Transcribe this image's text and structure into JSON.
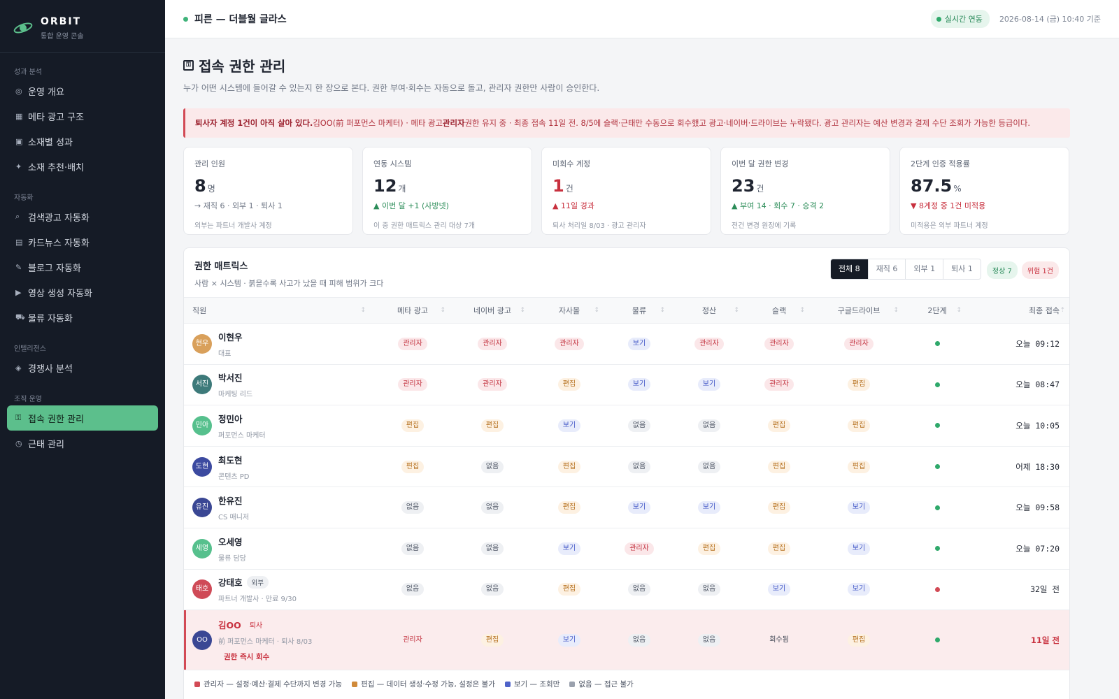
{
  "brand": {
    "name": "ORBIT",
    "sub": "통합 운영 콘솔"
  },
  "nav": [
    {
      "section": "성과 분석",
      "items": [
        {
          "label": "운영 개요",
          "icon": "◎",
          "icon_name": "target-icon"
        },
        {
          "label": "메타 광고 구조",
          "icon": "▦",
          "icon_name": "grid-icon"
        },
        {
          "label": "소재별 성과",
          "icon": "▣",
          "icon_name": "square-icon"
        },
        {
          "label": "소재 추천·배치",
          "icon": "✦",
          "icon_name": "sparkle-icon"
        }
      ]
    },
    {
      "section": "자동화",
      "items": [
        {
          "label": "검색광고 자동화",
          "icon": "⌕",
          "icon_name": "search-icon"
        },
        {
          "label": "카드뉴스 자동화",
          "icon": "▤",
          "icon_name": "cards-icon"
        },
        {
          "label": "블로그 자동화",
          "icon": "✎",
          "icon_name": "pencil-icon"
        },
        {
          "label": "영상 생성 자동화",
          "icon": "▶",
          "icon_name": "play-icon"
        },
        {
          "label": "물류 자동화",
          "icon": "⛟",
          "icon_name": "truck-icon"
        }
      ]
    },
    {
      "section": "인텔리전스",
      "items": [
        {
          "label": "경쟁사 분석",
          "icon": "◈",
          "icon_name": "diamond-icon"
        }
      ]
    },
    {
      "section": "조직 운영",
      "items": [
        {
          "label": "접속 권한 관리",
          "icon": "⚿",
          "icon_name": "key-icon",
          "active": true
        },
        {
          "label": "근태 관리",
          "icon": "◷",
          "icon_name": "clock-icon"
        }
      ]
    }
  ],
  "topbar": {
    "title": "피른 — 더블월 글라스",
    "live": "실시간 연동",
    "time": "2026-08-14 (금) 10:40 기준"
  },
  "page": {
    "title": "접속 권한 관리",
    "desc": "누가 어떤 시스템에 들어갈 수 있는지 한 장으로 본다. 권한 부여·회수는 자동으로 돌고, 관리자 권한만 사람이 승인한다."
  },
  "alert": {
    "lead": "퇴사자 계정 1건이 아직 살아 있다.",
    "text1": " 김OO(前 퍼포먼스 마케터) · 메타 광고 ",
    "strong": "관리자",
    "text2": " 권한 유지 중 · 최종 접속 11일 전. 8/5에 슬랙·근태만 수동으로 회수했고 광고·네이버·드라이브는 누락됐다. 광고 관리자는 예산 변경과 결제 수단 조회가 가능한 등급이다."
  },
  "kpis": [
    {
      "label": "관리 인원",
      "value": "8",
      "unit": "명",
      "delta": "→ 재직 6 · 외부 1 · 퇴사 1",
      "tone": "neutral",
      "note": "외부는 파트너 개발사 계정"
    },
    {
      "label": "연동 시스템",
      "value": "12",
      "unit": "개",
      "delta": "▲ 이번 달 +1 (사방넷)",
      "tone": "green",
      "note": "이 중 권한 매트릭스 관리 대상 7개"
    },
    {
      "label": "미회수 계정",
      "value": "1",
      "unit": "건",
      "delta": "▲ 11일 경과",
      "tone": "red",
      "note": "퇴사 처리일 8/03 · 광고 관리자",
      "value_red": true
    },
    {
      "label": "이번 달 권한 변경",
      "value": "23",
      "unit": "건",
      "delta": "▲ 부여 14 · 회수 7 · 승격 2",
      "tone": "green",
      "note": "전건 변경 원장에 기록"
    },
    {
      "label": "2단계 인증 적용률",
      "value": "87.5",
      "unit": "%",
      "delta": "▼ 8계정 중 1건 미적용",
      "tone": "red",
      "note": "미적용은 외부 파트너 계정"
    }
  ],
  "matrix": {
    "title": "권한 매트릭스",
    "sub": "사람 × 시스템 · 붉을수록 사고가 났을 때 피해 범위가 크다",
    "filters": [
      "전체 8",
      "재직 6",
      "외부 1",
      "퇴사 1"
    ],
    "ok": "정상 7",
    "risk": "위험 1건",
    "columns": [
      "직원",
      "메타 광고",
      "네이버 광고",
      "자사몰",
      "물류",
      "정산",
      "슬랙",
      "구글드라이브",
      "2단계",
      "최종 접속"
    ],
    "rows": [
      {
        "initials": "현우",
        "color": "#d9a05b",
        "name": "이현우",
        "role": "대표",
        "perms": [
          "관리자",
          "관리자",
          "관리자",
          "보기",
          "관리자",
          "관리자",
          "관리자"
        ],
        "mfa": true,
        "last": "오늘 09:12"
      },
      {
        "initials": "서진",
        "color": "#3d7a7a",
        "name": "박서진",
        "role": "마케팅 리드",
        "perms": [
          "관리자",
          "관리자",
          "편집",
          "보기",
          "보기",
          "관리자",
          "편집"
        ],
        "mfa": true,
        "last": "오늘 08:47"
      },
      {
        "initials": "민아",
        "color": "#56c08d",
        "name": "정민아",
        "role": "퍼포먼스 마케터",
        "perms": [
          "편집",
          "편집",
          "보기",
          "없음",
          "없음",
          "편집",
          "편집"
        ],
        "mfa": true,
        "last": "오늘 10:05"
      },
      {
        "initials": "도현",
        "color": "#3c4aa0",
        "name": "최도현",
        "role": "콘텐츠 PD",
        "perms": [
          "편집",
          "없음",
          "편집",
          "없음",
          "없음",
          "편집",
          "편집"
        ],
        "mfa": true,
        "last": "어제 18:30"
      },
      {
        "initials": "유진",
        "color": "#3a4794",
        "name": "한유진",
        "role": "CS 매니저",
        "perms": [
          "없음",
          "없음",
          "편집",
          "보기",
          "보기",
          "편집",
          "보기"
        ],
        "mfa": true,
        "last": "오늘 09:58"
      },
      {
        "initials": "세영",
        "color": "#56c08d",
        "name": "오세영",
        "role": "물류 담당",
        "perms": [
          "없음",
          "없음",
          "보기",
          "관리자",
          "편집",
          "편집",
          "보기"
        ],
        "mfa": true,
        "last": "오늘 07:20"
      },
      {
        "initials": "태호",
        "color": "#cf4a57",
        "name": "강태호",
        "role": "파트너 개발사 · 만료 9/30",
        "tag": "외부",
        "perms": [
          "없음",
          "없음",
          "편집",
          "없음",
          "없음",
          "보기",
          "보기"
        ],
        "mfa": false,
        "last": "32일 전"
      },
      {
        "initials": "OO",
        "color": "#3a4794",
        "name": "김OO",
        "role": "前 퍼포먼스 마케터 · 퇴사 8/03",
        "tag_out": "퇴사",
        "action": "권한 즉시 회수",
        "flag": true,
        "perms": [
          "관리자",
          "편집",
          "보기",
          "없음",
          "없음",
          "회수됨",
          "편집"
        ],
        "mfa": true,
        "last": "11일 전"
      }
    ]
  },
  "legend": [
    {
      "label": "관리자 — 설정·예산·결제 수단까지 변경 가능",
      "color": "#d24a55"
    },
    {
      "label": "편집 — 데이터 생성·수정 가능, 설정은 불가",
      "color": "#d08a3a"
    },
    {
      "label": "보기 — 조회만",
      "color": "#4f63c9"
    },
    {
      "label": "없음 — 접근 불가",
      "color": "#9aa1ad"
    }
  ]
}
